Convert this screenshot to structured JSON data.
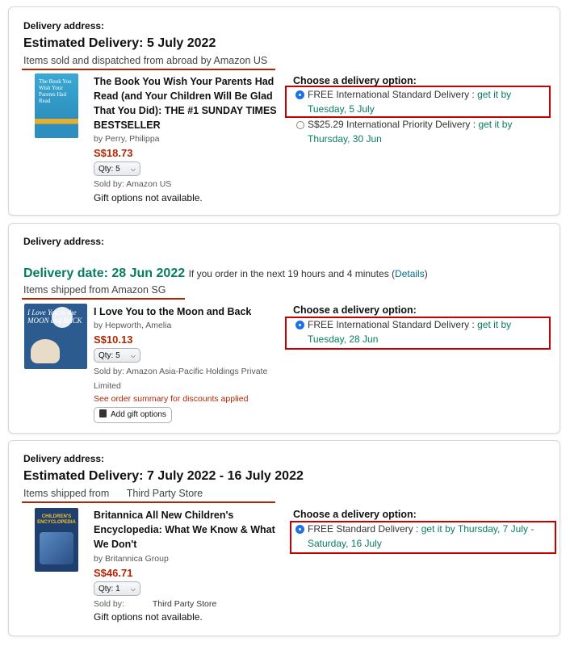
{
  "shipments": [
    {
      "delivery_address_label": "Delivery address:",
      "heading": "Estimated Delivery: 5 July 2022",
      "source": "Items sold and dispatched from abroad by Amazon US",
      "item": {
        "cover_text": "The Book You Wish Your Parents Had Read",
        "title": "The Book You Wish Your Parents Had Read (and Your Children Will Be Glad That You Did): THE #1 SUNDAY TIMES BESTSELLER",
        "author": "by Perry, Philippa",
        "price": "S$18.73",
        "qty": "Qty: 5",
        "sold_by": "Sold by: Amazon US",
        "gift": "Gift options not available."
      },
      "choose_label": "Choose a delivery option:",
      "options": [
        {
          "prefix": "FREE International Standard Delivery :",
          "get_it": "get it by",
          "date": "Tuesday, 5 July"
        },
        {
          "prefix": "S$25.29 International Priority Delivery :",
          "get_it": "get it by",
          "date": "Thursday, 30 Jun"
        }
      ]
    },
    {
      "delivery_address_label": "Delivery address:",
      "heading": "Delivery date: 28 Jun 2022",
      "heading_note": "If you order in the next 19 hours and 4 minutes (",
      "details_link": "Details",
      "heading_note_end": ")",
      "source": "Items shipped from Amazon SG",
      "item": {
        "cover_text": "I Love You to the MOON and BACK",
        "title": "I Love You to the Moon and Back",
        "author": "by Hepworth, Amelia",
        "price": "S$10.13",
        "qty": "Qty: 5",
        "sold_by": "Sold by: Amazon Asia-Pacific Holdings Private Limited",
        "discount": "See order summary for discounts applied",
        "gift_button": "Add gift options"
      },
      "choose_label": "Choose a delivery option:",
      "options": [
        {
          "prefix": "FREE International Standard Delivery :",
          "get_it": "get it by",
          "date": "Tuesday, 28 Jun"
        }
      ]
    },
    {
      "delivery_address_label": "Delivery address:",
      "heading": "Estimated Delivery: 7 July 2022 - 16 July 2022",
      "source_prefix": "Items shipped from",
      "source_store": "Third Party Store",
      "item": {
        "cover_text": "CHILDREN'S ENCYCLOPEDIA",
        "title": "Britannica All New Children's Encyclopedia: What We Know & What We Don't",
        "author": "by Britannica Group",
        "price": "S$46.71",
        "qty": "Qty: 1",
        "sold_by_label": "Sold by:",
        "sold_by_store": "Third Party Store",
        "gift": "Gift options not available."
      },
      "choose_label": "Choose a delivery option:",
      "options": [
        {
          "prefix": "FREE Standard Delivery :",
          "get_it": "get it by Thursday, 7 July -",
          "date": "Saturday, 16 July"
        }
      ]
    }
  ],
  "colors": {
    "accent_green": "#067d62",
    "price_red": "#b12704",
    "highlight_red": "#c40000",
    "radio_blue": "#1a73e8"
  }
}
